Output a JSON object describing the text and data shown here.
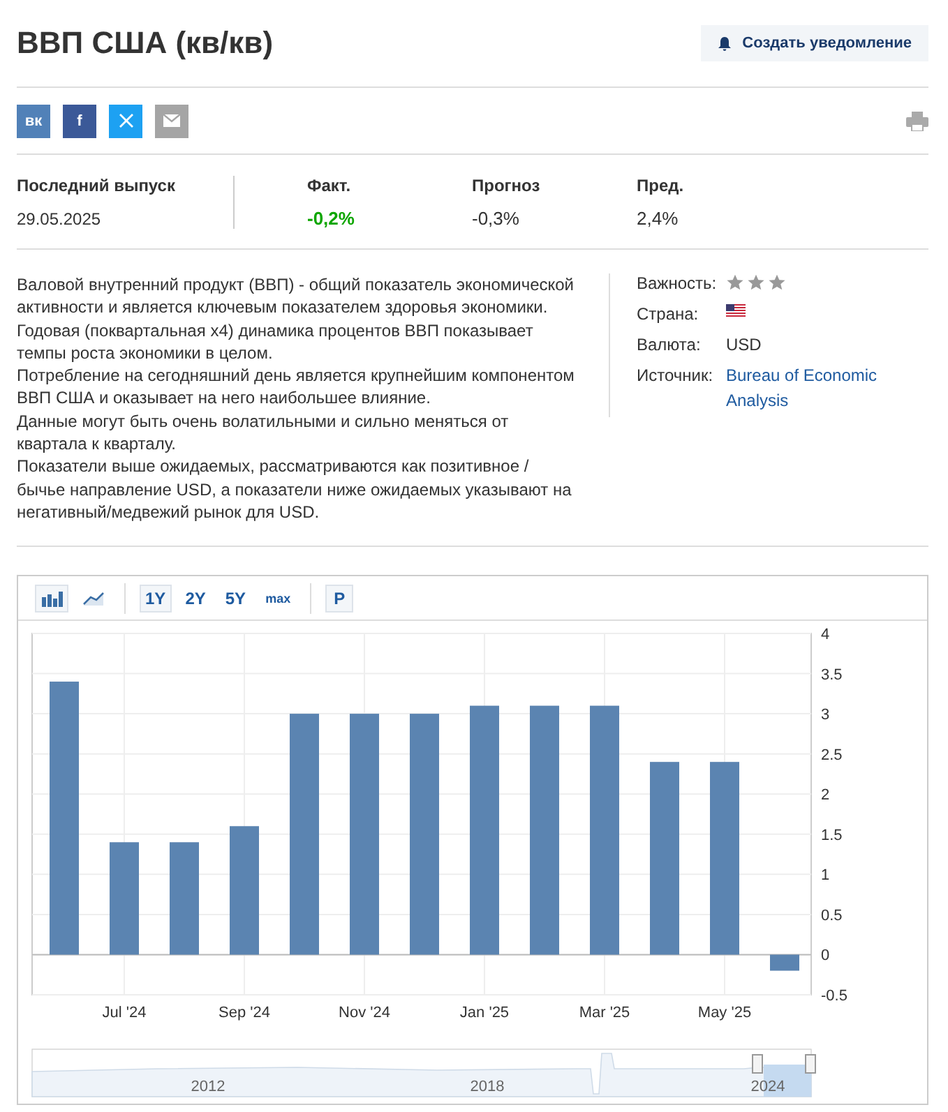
{
  "title": "ВВП США (кв/кв)",
  "alert_button": {
    "label": "Создать уведомление"
  },
  "share_buttons": [
    {
      "kind": "vk",
      "label": "вк"
    },
    {
      "kind": "facebook",
      "label": "f"
    },
    {
      "kind": "x"
    },
    {
      "kind": "email"
    }
  ],
  "latest_release": {
    "label": "Последний выпуск",
    "date": "29.05.2025"
  },
  "stats": [
    {
      "label": "Факт.",
      "value": "-0,2%",
      "kind": "actual"
    },
    {
      "label": "Прогноз",
      "value": "-0,3%",
      "kind": "plain"
    },
    {
      "label": "Пред.",
      "value": "2,4%",
      "kind": "plain"
    }
  ],
  "description": [
    "Валовой внутренний продукт (ВВП) - общий показатель экономической активности и является ключевым показателем здоровья экономики.",
    "Годовая (поквартальная x4) динамика процентов ВВП показывает темпы роста экономики в целом.",
    "Потребление на сегодняшний день является крупнейшим компонентом ВВП США и оказывает на него наибольшее влияние.",
    "Данные могут быть очень волатильными и сильно меняться от квартала к кварталу.",
    "Показатели выше ожидаемых, рассматриваются как позитивное / бычье направление USD, а показатели ниже ожидаемых указывают на негативный/медвежий рынок для USD."
  ],
  "info": [
    {
      "kind": "stars",
      "label": "Важность:",
      "stars": 3
    },
    {
      "kind": "flag",
      "label": "Страна:"
    },
    {
      "kind": "text",
      "label": "Валюта:",
      "value": "USD"
    },
    {
      "kind": "link",
      "label": "Источник:",
      "value": "Bureau of Economic Analysis"
    }
  ],
  "chart_toolbar": {
    "types": [
      {
        "kind": "bar",
        "selected": true
      },
      {
        "kind": "line",
        "selected": false
      }
    ],
    "ranges": [
      {
        "label": "1Y",
        "selected": true
      },
      {
        "label": "2Y",
        "selected": false
      },
      {
        "label": "5Y",
        "selected": false
      },
      {
        "label": "max",
        "selected": false
      }
    ],
    "extra": [
      {
        "label": "P",
        "selected": true
      }
    ]
  },
  "chart_data": {
    "type": "bar",
    "categories": [
      null,
      "Jul '24",
      null,
      "Sep '24",
      null,
      "Nov '24",
      null,
      "Jan '25",
      null,
      "Mar '25",
      null,
      "May '25",
      null
    ],
    "series": [
      {
        "color": "#5b84b1",
        "values": [
          3.4,
          1.4,
          1.4,
          1.6,
          3.0,
          3.0,
          3.0,
          3.1,
          3.1,
          3.1,
          2.4,
          2.4,
          -0.2
        ]
      }
    ],
    "ylim": [
      -0.5,
      4
    ],
    "grid": true,
    "yticks": [
      {
        "value": 4,
        "label": "4"
      },
      {
        "value": 3.5,
        "label": "3.5"
      },
      {
        "value": 3,
        "label": "3"
      },
      {
        "value": 2.5,
        "label": "2.5"
      },
      {
        "value": 2,
        "label": "2"
      },
      {
        "value": 1.5,
        "label": "1.5"
      },
      {
        "value": 1,
        "label": "1"
      },
      {
        "value": 0.5,
        "label": "0.5"
      },
      {
        "value": 0,
        "label": "0"
      },
      {
        "value": -0.5,
        "label": "-0.5"
      }
    ]
  },
  "navigator": {
    "labels": [
      "2012",
      "2018",
      "2024"
    ]
  }
}
